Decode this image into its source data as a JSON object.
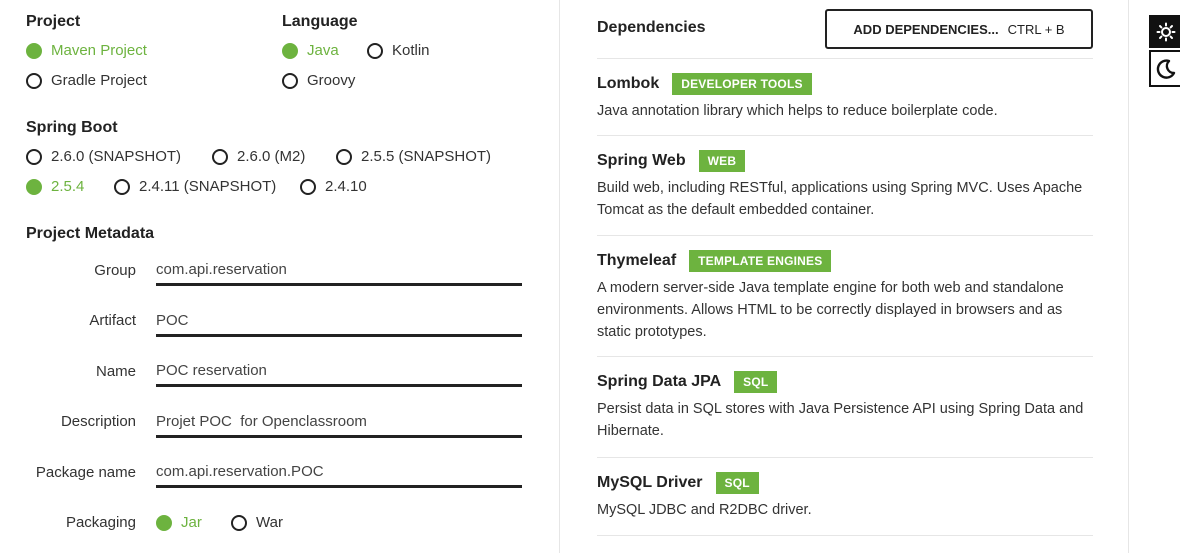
{
  "project": {
    "title": "Project",
    "options": [
      {
        "label": "Maven Project",
        "checked": true
      },
      {
        "label": "Gradle Project",
        "checked": false
      }
    ]
  },
  "language": {
    "title": "Language",
    "options": [
      {
        "label": "Java",
        "checked": true
      },
      {
        "label": "Kotlin",
        "checked": false
      },
      {
        "label": "Groovy",
        "checked": false
      }
    ]
  },
  "spring_boot": {
    "title": "Spring Boot",
    "options": [
      {
        "label": "2.6.0 (SNAPSHOT)",
        "checked": false
      },
      {
        "label": "2.6.0 (M2)",
        "checked": false
      },
      {
        "label": "2.5.5 (SNAPSHOT)",
        "checked": false
      },
      {
        "label": "2.5.4",
        "checked": true
      },
      {
        "label": "2.4.11 (SNAPSHOT)",
        "checked": false
      },
      {
        "label": "2.4.10",
        "checked": false
      }
    ]
  },
  "metadata": {
    "title": "Project Metadata",
    "fields": [
      {
        "label": "Group",
        "value": "com.api.reservation"
      },
      {
        "label": "Artifact",
        "value": "POC"
      },
      {
        "label": "Name",
        "value": "POC reservation"
      },
      {
        "label": "Description",
        "value": "Projet POC  for Openclassroom"
      },
      {
        "label": "Package name",
        "value": "com.api.reservation.POC"
      }
    ],
    "packaging": {
      "label": "Packaging",
      "options": [
        {
          "label": "Jar",
          "checked": true
        },
        {
          "label": "War",
          "checked": false
        }
      ]
    }
  },
  "dependencies": {
    "title": "Dependencies",
    "add_button": {
      "label": "ADD DEPENDENCIES...",
      "shortcut": "CTRL + B"
    },
    "items": [
      {
        "name": "Lombok",
        "badge": "DEVELOPER TOOLS",
        "description": "Java annotation library which helps to reduce boilerplate code."
      },
      {
        "name": "Spring Web",
        "badge": "WEB",
        "description": "Build web, including RESTful, applications using Spring MVC. Uses Apache Tomcat as the default embedded container."
      },
      {
        "name": "Thymeleaf",
        "badge": "TEMPLATE ENGINES",
        "description": "A modern server-side Java template engine for both web and standalone environments. Allows HTML to be correctly displayed in browsers and as static prototypes."
      },
      {
        "name": "Spring Data JPA",
        "badge": "SQL",
        "description": "Persist data in SQL stores with Java Persistence API using Spring Data and Hibernate."
      },
      {
        "name": "MySQL Driver",
        "badge": "SQL",
        "description": "MySQL JDBC and R2DBC driver."
      }
    ]
  },
  "theme": {
    "light_icon": "sun-icon",
    "dark_icon": "moon-icon"
  },
  "colors": {
    "accent": "#6db33f",
    "text": "#222222"
  }
}
